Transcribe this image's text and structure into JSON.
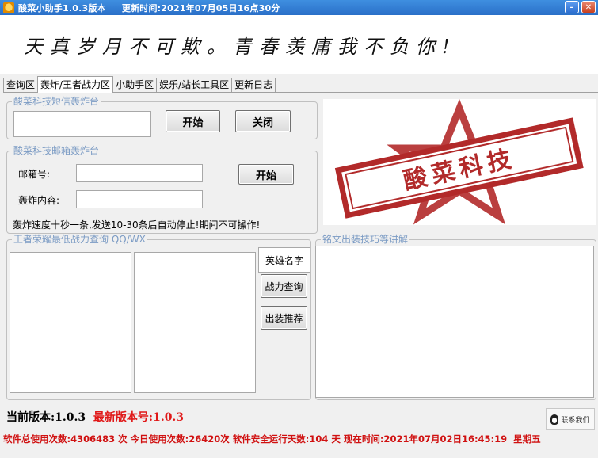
{
  "window": {
    "title": "酸菜小助手1.0.3版本     更新时间:2021年07月05日16点30分",
    "minimize_glyph": "–",
    "close_glyph": "✕"
  },
  "banner": {
    "text": "天真岁月不可欺。青春羡庸我不负你!"
  },
  "tabs": [
    {
      "label": "查询区"
    },
    {
      "label": "轰炸/王者战力区"
    },
    {
      "label": "小助手区"
    },
    {
      "label": "娱乐/站长工具区"
    },
    {
      "label": "更新日志"
    }
  ],
  "sms_group": {
    "legend": "酸菜科技短信轰炸台",
    "start_label": "开始",
    "close_label": "关闭",
    "phone_value": ""
  },
  "mail_group": {
    "legend": "酸菜科技邮箱轰炸台",
    "mailbox_label": "邮箱号:",
    "content_label": "轰炸内容:",
    "start_label": "开始",
    "notice": "轰炸速度十秒一条,发送10-30条后自动停止!期间不可操作!"
  },
  "logo": {
    "text": "酸菜科技",
    "color": "#b22a2a"
  },
  "king_group": {
    "legend": "王者荣耀最低战力查询  QQ/WX",
    "hero_name_label": "英雄名字",
    "query_button": "战力查询",
    "equip_button": "出装推荐"
  },
  "inscription_group": {
    "legend": "铭文出装技巧等讲解"
  },
  "footer": {
    "current_version_label": "当前版本:",
    "current_version": "1.0.3",
    "latest_version_label": "最新版本号:",
    "latest_version": "1.0.3",
    "contact_label": "联系我们",
    "status": "软件总使用次数:4306483 次 今日使用次数:26420次 软件安全运行天数:104 天 现在时间:2021年07月02日16:45:19  星期五"
  }
}
